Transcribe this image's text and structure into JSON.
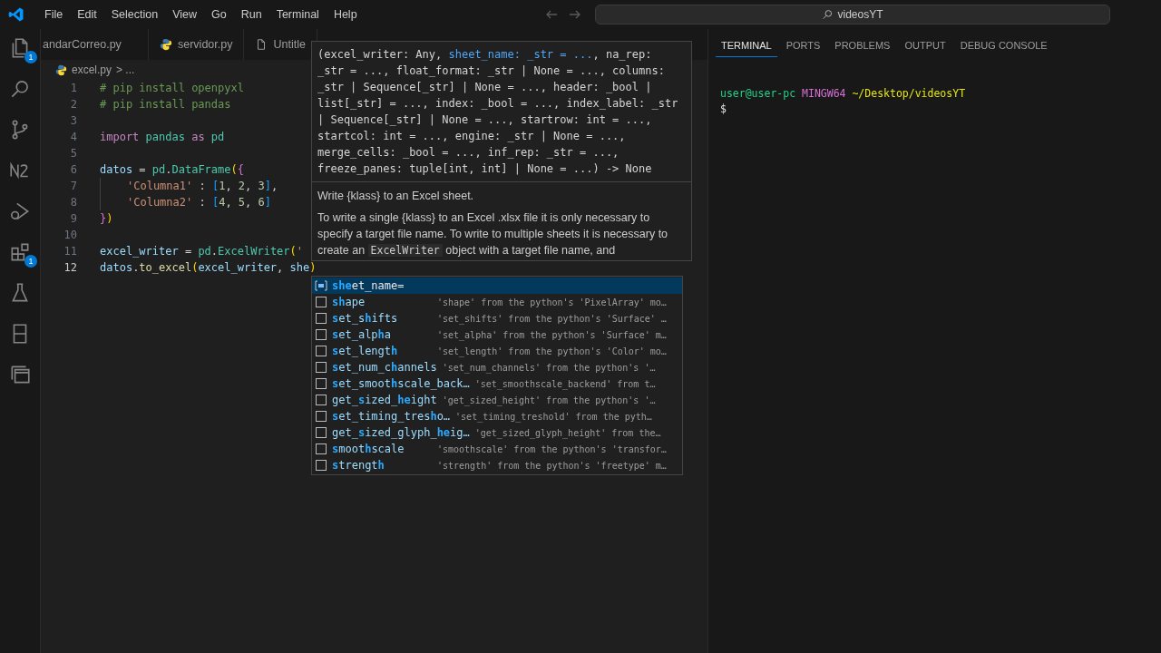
{
  "menu": [
    "File",
    "Edit",
    "Selection",
    "View",
    "Go",
    "Run",
    "Terminal",
    "Help"
  ],
  "search": {
    "value": "videosYT"
  },
  "activity_bar": [
    {
      "kind": "files",
      "badge": "1"
    },
    {
      "kind": "search"
    },
    {
      "kind": "git"
    },
    {
      "kind": "n2"
    },
    {
      "kind": "debug"
    },
    {
      "kind": "extensions",
      "badge": "1"
    },
    {
      "kind": "flask"
    },
    {
      "kind": "panel"
    },
    {
      "kind": "windows"
    }
  ],
  "editor_tabs": [
    {
      "label": "andarCorreo.py",
      "kind": "plain"
    },
    {
      "label": "servidor.py",
      "kind": "python"
    },
    {
      "label": "Untitle",
      "kind": "file"
    }
  ],
  "breadcrumb": {
    "file": "excel.py",
    "rest": "> ..."
  },
  "code_lines": [
    {
      "number": "1",
      "current": false,
      "tokens": [
        {
          "t": "# pip install openpyxl",
          "kind": "comment"
        }
      ]
    },
    {
      "number": "2",
      "current": false,
      "tokens": [
        {
          "t": "# pip install pandas",
          "kind": "comment"
        }
      ]
    },
    {
      "number": "3",
      "current": false
    },
    {
      "number": "4",
      "current": false,
      "tokens": [
        {
          "t": "import ",
          "kind": "keyword"
        },
        {
          "t": "pandas ",
          "kind": "module"
        },
        {
          "t": "as ",
          "kind": "keyword"
        },
        {
          "t": "pd",
          "kind": "module"
        }
      ]
    },
    {
      "number": "5",
      "current": false
    },
    {
      "number": "6",
      "current": false,
      "tokens": [
        {
          "t": "datos",
          "kind": "variable"
        },
        {
          "t": " = ",
          "kind": "plain"
        },
        {
          "t": "pd",
          "kind": "module"
        },
        {
          "t": ".",
          "kind": "plain"
        },
        {
          "t": "DataFrame",
          "kind": "class"
        },
        {
          "t": "(",
          "kind": "bracket1"
        },
        {
          "t": "{",
          "kind": "bracket2"
        }
      ]
    },
    {
      "number": "7",
      "current": false,
      "indented": true,
      "tokens": [
        {
          "t": "'Columna1'",
          "kind": "string"
        },
        {
          "t": " : ",
          "kind": "plain"
        },
        {
          "t": "[",
          "kind": "bracket3"
        },
        {
          "t": "1",
          "kind": "number"
        },
        {
          "t": ", ",
          "kind": "plain"
        },
        {
          "t": "2",
          "kind": "number"
        },
        {
          "t": ", ",
          "kind": "plain"
        },
        {
          "t": "3",
          "kind": "number"
        },
        {
          "t": "]",
          "kind": "bracket3"
        },
        {
          "t": ",",
          "kind": "plain"
        }
      ]
    },
    {
      "number": "8",
      "current": false,
      "indented": true,
      "tokens": [
        {
          "t": "'Columna2'",
          "kind": "string"
        },
        {
          "t": " : ",
          "kind": "plain"
        },
        {
          "t": "[",
          "kind": "bracket3"
        },
        {
          "t": "4",
          "kind": "number"
        },
        {
          "t": ", ",
          "kind": "plain"
        },
        {
          "t": "5",
          "kind": "number"
        },
        {
          "t": ", ",
          "kind": "plain"
        },
        {
          "t": "6",
          "kind": "number"
        },
        {
          "t": "]",
          "kind": "bracket3"
        }
      ]
    },
    {
      "number": "9",
      "current": false,
      "tokens": [
        {
          "t": "}",
          "kind": "bracket2"
        },
        {
          "t": ")",
          "kind": "bracket1"
        }
      ]
    },
    {
      "number": "10",
      "current": false
    },
    {
      "number": "11",
      "current": false,
      "tokens": [
        {
          "t": "excel_writer",
          "kind": "variable"
        },
        {
          "t": " = ",
          "kind": "plain"
        },
        {
          "t": "pd",
          "kind": "module"
        },
        {
          "t": ".",
          "kind": "plain"
        },
        {
          "t": "ExcelWriter",
          "kind": "class"
        },
        {
          "t": "(",
          "kind": "bracket1"
        },
        {
          "t": "'",
          "kind": "string"
        }
      ]
    },
    {
      "number": "12",
      "current": true,
      "tokens": [
        {
          "t": "datos",
          "kind": "variable"
        },
        {
          "t": ".",
          "kind": "plain"
        },
        {
          "t": "to_excel",
          "kind": "function"
        },
        {
          "t": "(",
          "kind": "bracket1"
        },
        {
          "t": "excel_writer",
          "kind": "variable"
        },
        {
          "t": ", ",
          "kind": "plain"
        },
        {
          "t": "she",
          "kind": "variable"
        },
        {
          "t": ")",
          "kind": "bracket1"
        }
      ]
    }
  ],
  "hover": {
    "first_line": {
      "before": "(excel_writer: Any, ",
      "active_param": "sheet_name: _str = ...",
      "after": ", na_rep:"
    },
    "signature_lines": [
      "_str = ..., float_format: _str | None = ..., columns:",
      "_str | Sequence[_str] | None = ..., header: _bool |",
      "list[_str] = ..., index: _bool = ..., index_label: _str",
      "| Sequence[_str] | None = ..., startrow: int = ...,",
      "startcol: int = ..., engine: _str | None = ...,",
      "merge_cells: _bool = ..., inf_rep: _str = ...,",
      "freeze_panes: tuple[int, int] | None = ...) -> None"
    ],
    "summary": "Write {klass} to an Excel sheet.",
    "body": [
      {
        "t": "To write a single {klass} to an Excel .xlsx file it is only necessary to specify a target file name. To write to multiple sheets it is necessary to create an ",
        "kind": "text"
      },
      {
        "t": "ExcelWriter",
        "kind": "code"
      },
      {
        "t": " object with a target file name, and",
        "kind": "text"
      }
    ]
  },
  "suggestions": [
    {
      "kind": "variable",
      "selected": true,
      "label": [
        {
          "t": "she",
          "kind": "match"
        },
        {
          "t": "et_name=",
          "kind": "rest"
        }
      ]
    },
    {
      "kind": "method",
      "selected": false,
      "label": [
        {
          "t": "sh",
          "kind": "match"
        },
        {
          "t": "ape",
          "kind": "rest"
        }
      ],
      "detail": "'shape' from the python's 'PixelArray' mo…"
    },
    {
      "kind": "method",
      "selected": false,
      "label": [
        {
          "t": "s",
          "kind": "match"
        },
        {
          "t": "et_s",
          "kind": "rest"
        },
        {
          "t": "h",
          "kind": "match"
        },
        {
          "t": "ifts",
          "kind": "rest"
        }
      ],
      "detail": "'set_shifts' from the python's 'Surface' …"
    },
    {
      "kind": "method",
      "selected": false,
      "label": [
        {
          "t": "s",
          "kind": "match"
        },
        {
          "t": "et_alp",
          "kind": "rest"
        },
        {
          "t": "h",
          "kind": "match"
        },
        {
          "t": "a",
          "kind": "rest"
        }
      ],
      "detail": "'set_alpha' from the python's 'Surface' m…"
    },
    {
      "kind": "method",
      "selected": false,
      "label": [
        {
          "t": "s",
          "kind": "match"
        },
        {
          "t": "et_lengt",
          "kind": "rest"
        },
        {
          "t": "h",
          "kind": "match"
        }
      ],
      "detail": "'set_length' from the python's 'Color' mo…"
    },
    {
      "kind": "method",
      "selected": false,
      "label": [
        {
          "t": "s",
          "kind": "match"
        },
        {
          "t": "et_num_c",
          "kind": "rest"
        },
        {
          "t": "h",
          "kind": "match"
        },
        {
          "t": "annels",
          "kind": "rest"
        }
      ],
      "detail": "'set_num_channels' from the python's '…"
    },
    {
      "kind": "method",
      "selected": false,
      "label": [
        {
          "t": "s",
          "kind": "match"
        },
        {
          "t": "et_smoot",
          "kind": "rest"
        },
        {
          "t": "h",
          "kind": "match"
        },
        {
          "t": "scale_back…",
          "kind": "rest"
        }
      ],
      "detail": "'set_smoothscale_backend' from t…"
    },
    {
      "kind": "method",
      "selected": false,
      "label": [
        {
          "t": "get_",
          "kind": "rest"
        },
        {
          "t": "s",
          "kind": "match"
        },
        {
          "t": "ized_",
          "kind": "rest"
        },
        {
          "t": "he",
          "kind": "match"
        },
        {
          "t": "ight",
          "kind": "rest"
        }
      ],
      "detail": "'get_sized_height' from the python's '…"
    },
    {
      "kind": "method",
      "selected": false,
      "label": [
        {
          "t": "s",
          "kind": "match"
        },
        {
          "t": "et_timing_tres",
          "kind": "rest"
        },
        {
          "t": "h",
          "kind": "match"
        },
        {
          "t": "o…",
          "kind": "rest"
        }
      ],
      "detail": "'set_timing_treshold' from the pyth…"
    },
    {
      "kind": "method",
      "selected": false,
      "label": [
        {
          "t": "get_",
          "kind": "rest"
        },
        {
          "t": "s",
          "kind": "match"
        },
        {
          "t": "ized_glyph_",
          "kind": "rest"
        },
        {
          "t": "he",
          "kind": "match"
        },
        {
          "t": "ig…",
          "kind": "rest"
        }
      ],
      "detail": "'get_sized_glyph_height' from the…"
    },
    {
      "kind": "method",
      "selected": false,
      "label": [
        {
          "t": "s",
          "kind": "match"
        },
        {
          "t": "moot",
          "kind": "rest"
        },
        {
          "t": "h",
          "kind": "match"
        },
        {
          "t": "scale",
          "kind": "rest"
        }
      ],
      "detail": "'smoothscale' from the python's 'transfor…"
    },
    {
      "kind": "method",
      "selected": false,
      "label": [
        {
          "t": "s",
          "kind": "match"
        },
        {
          "t": "trengt",
          "kind": "rest"
        },
        {
          "t": "h",
          "kind": "match"
        }
      ],
      "detail": "'strength' from the python's 'freetype' m…"
    }
  ],
  "panel_tabs": [
    {
      "label": "TERMINAL",
      "selected": true
    },
    {
      "label": "PORTS",
      "selected": false
    },
    {
      "label": "PROBLEMS",
      "selected": false
    },
    {
      "label": "OUTPUT",
      "selected": false
    },
    {
      "label": "DEBUG CONSOLE",
      "selected": false
    }
  ],
  "terminal": {
    "user": "user@user-pc",
    "system": "MINGW64",
    "path": "~/Desktop/videosYT",
    "prompt": "$"
  }
}
